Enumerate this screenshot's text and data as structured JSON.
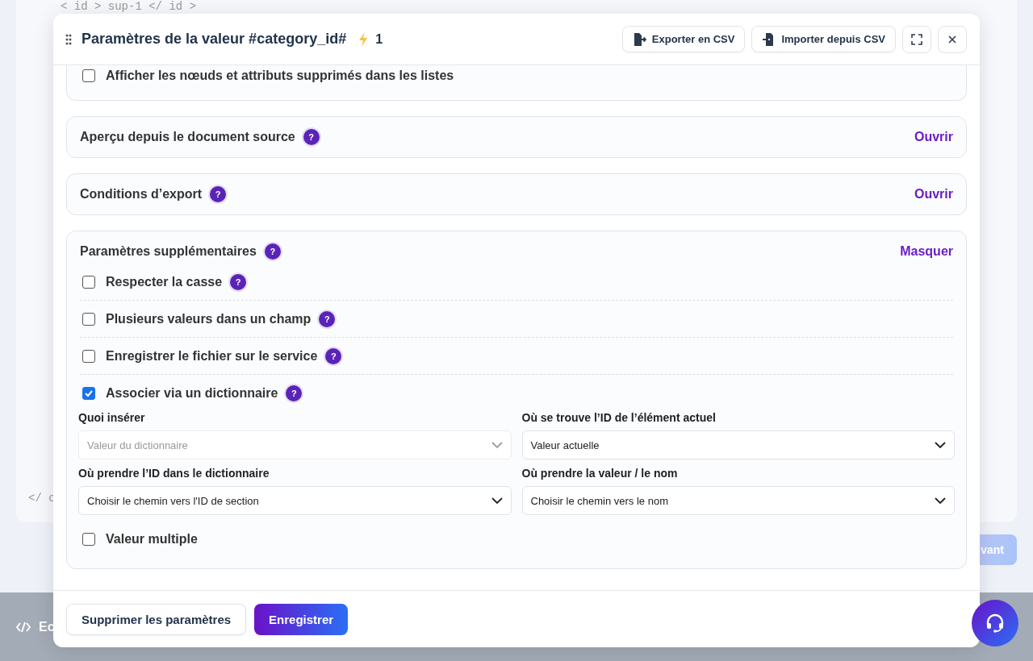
{
  "background": {
    "code_lines": [
      "< id > sup-1 </ id >",
      "</ c"
    ],
    "footer_label": "Ec",
    "next_button": "vant"
  },
  "dialog": {
    "title": "Paramètres de la valeur #category_id#",
    "bolt_count": "1",
    "actions": [
      {
        "label": "Exporter en CSV",
        "kind": "export"
      },
      {
        "label": "Importer depuis CSV",
        "kind": "import"
      }
    ],
    "sections": [
      {
        "kind": "options",
        "options": [
          {
            "label": "Afficher les nœuds et attributs supprimés dans les listes",
            "checked": false
          }
        ]
      },
      {
        "kind": "collapsed",
        "title": "Aperçu depuis le document source",
        "help": "?",
        "toggle": "Ouvrir"
      },
      {
        "kind": "collapsed",
        "title": "Conditions d’export",
        "help": "?",
        "toggle": "Ouvrir"
      },
      {
        "kind": "expanded",
        "title": "Paramètres supplémentaires",
        "help": "?",
        "toggle": "Masquer",
        "options": [
          {
            "label": "Respecter la casse",
            "checked": false,
            "help": "?"
          },
          {
            "label": "Plusieurs valeurs dans un champ",
            "checked": false,
            "help": "?"
          },
          {
            "label": "Enregistrer le fichier sur le service",
            "checked": false,
            "help": "?"
          },
          {
            "label": "Associer via un dictionnaire",
            "checked": true,
            "help": "?"
          }
        ],
        "fields": [
          {
            "label": "Quoi insérer",
            "value": "Valeur du dictionnaire",
            "disabled": true
          },
          {
            "label": "Où se trouve l’ID de l’élément actuel",
            "value": "Valeur actuelle",
            "disabled": false
          },
          {
            "label": "Où prendre l’ID dans le dictionnaire",
            "value": "Choisir le chemin vers l'ID de section",
            "disabled": false
          },
          {
            "label": "Où prendre la valeur / le nom",
            "value": "Choisir le chemin vers le nom",
            "disabled": false
          }
        ],
        "after": [
          {
            "label": "Valeur multiple",
            "checked": false
          }
        ]
      }
    ],
    "footer_buttons": [
      {
        "label": "Supprimer les paramètres",
        "kind": "secondary"
      },
      {
        "label": "Enregistrer",
        "kind": "primary"
      }
    ]
  }
}
